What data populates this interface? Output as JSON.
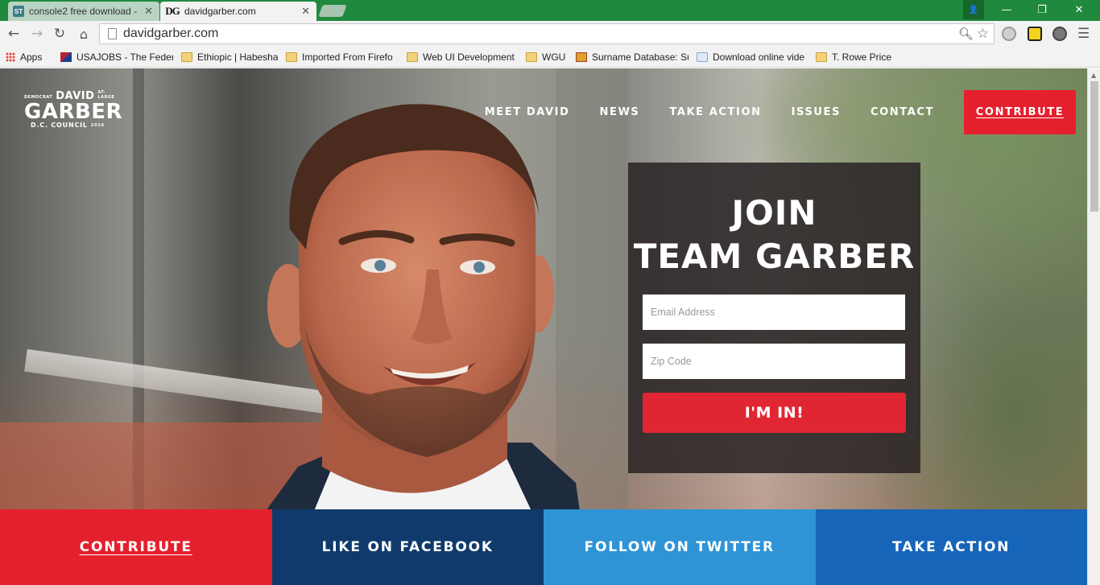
{
  "browser": {
    "tabs": [
      {
        "title": "console2 free download -",
        "favicon": "ST"
      },
      {
        "title": "davidgarber.com",
        "favicon": "DG"
      }
    ],
    "url": "davidgarber.com",
    "bookmarks": [
      {
        "label": "Apps",
        "icon": "apps-grid-icon"
      },
      {
        "label": "USAJOBS - The Feder",
        "icon": "usajobs-icon"
      },
      {
        "label": "Ethiopic | Habesha",
        "icon": "folder-icon"
      },
      {
        "label": "Imported From Firefo",
        "icon": "folder-icon"
      },
      {
        "label": "Web UI Development",
        "icon": "folder-icon"
      },
      {
        "label": "WGU",
        "icon": "folder-icon"
      },
      {
        "label": "Surname Database: Su",
        "icon": "surname-icon"
      },
      {
        "label": "Download online vide",
        "icon": "video-icon"
      },
      {
        "label": "T. Rowe Price",
        "icon": "folder-icon"
      }
    ]
  },
  "logo": {
    "tag_left": "DEMOCRAT",
    "first_name": "DAVID",
    "tag_right": "AT-LARGE",
    "last_name": "GARBER",
    "office": "D.C. COUNCIL",
    "year": "2016"
  },
  "nav": {
    "items": [
      "MEET DAVID",
      "NEWS",
      "TAKE ACTION",
      "ISSUES",
      "CONTACT"
    ],
    "contribute": "CONTRIBUTE"
  },
  "signup": {
    "title_line1": "JOIN",
    "title_line2": "TEAM GARBER",
    "email_placeholder": "Email Address",
    "zip_placeholder": "Zip Code",
    "submit_label": "I'M IN!"
  },
  "action_bar": {
    "contribute": "CONTRIBUTE",
    "facebook": "LIKE ON FACEBOOK",
    "twitter": "FOLLOW ON TWITTER",
    "take_action": "TAKE ACTION"
  },
  "colors": {
    "titlebar": "#1f8a3e",
    "brand_red": "#e5202e",
    "facebook_navy": "#0f3a6b",
    "twitter_blue": "#2f94d6",
    "action_blue": "#1765b8",
    "panel": "#2b2626"
  }
}
